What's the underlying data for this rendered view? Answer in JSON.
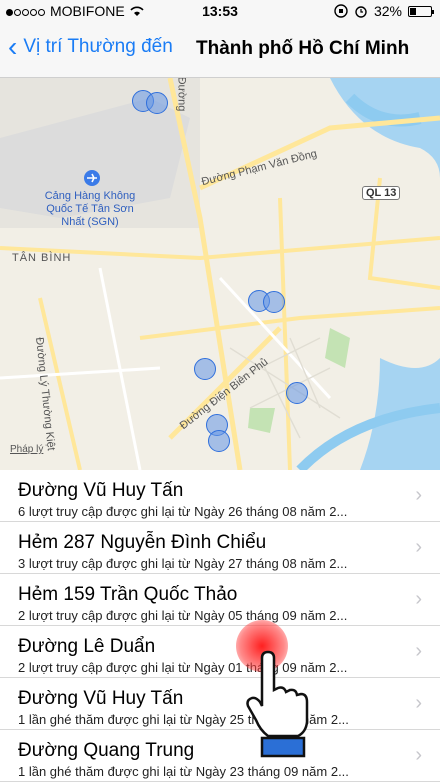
{
  "status_bar": {
    "carrier": "MOBIFONE",
    "time": "13:53",
    "battery": "32%",
    "battery_level": 0.32
  },
  "nav": {
    "back_label": "Vị trí Thường đến",
    "title": "Thành phố Hồ Chí Minh"
  },
  "map": {
    "labels": {
      "airport": "Cảng Hàng Không Quốc Tế Tân Sơn Nhất (SGN)",
      "district": "TÂN BÌNH",
      "road1": "Đường Phạm Văn Đồng",
      "road2": "Đường Điện Biên Phủ",
      "road3": "Đường Lý Thường Kiệt",
      "road4": "Đường",
      "highway": "QL 13",
      "legal": "Pháp lý"
    }
  },
  "list": {
    "items": [
      {
        "title": "Đường Vũ Huy Tấn",
        "subtitle": "6 lượt truy cập được ghi lại từ Ngày 26 tháng 08 năm 2..."
      },
      {
        "title": "Hẻm 287 Nguyễn Đình Chiểu",
        "subtitle": "3 lượt truy cập được ghi lại từ Ngày 27 tháng 08 năm 2..."
      },
      {
        "title": "Hẻm 159 Trần Quốc Thảo",
        "subtitle": "2 lượt truy cập được ghi lại từ Ngày 05 tháng 09 năm 2..."
      },
      {
        "title": "Đường Lê Duẩn",
        "subtitle": "2 lượt truy cập được ghi lại từ Ngày 01 tháng 09 năm 2..."
      },
      {
        "title": "Đường Vũ Huy Tấn",
        "subtitle": "1 lần ghé thăm được ghi lại từ Ngày 25 tháng 09 năm 2..."
      },
      {
        "title": "Đường Quang Trung",
        "subtitle": "1 lần ghé thăm được ghi lại từ Ngày 23 tháng 09 năm 2..."
      }
    ]
  },
  "colors": {
    "accent": "#1a7cf5",
    "pin": "#2f6fdc"
  }
}
